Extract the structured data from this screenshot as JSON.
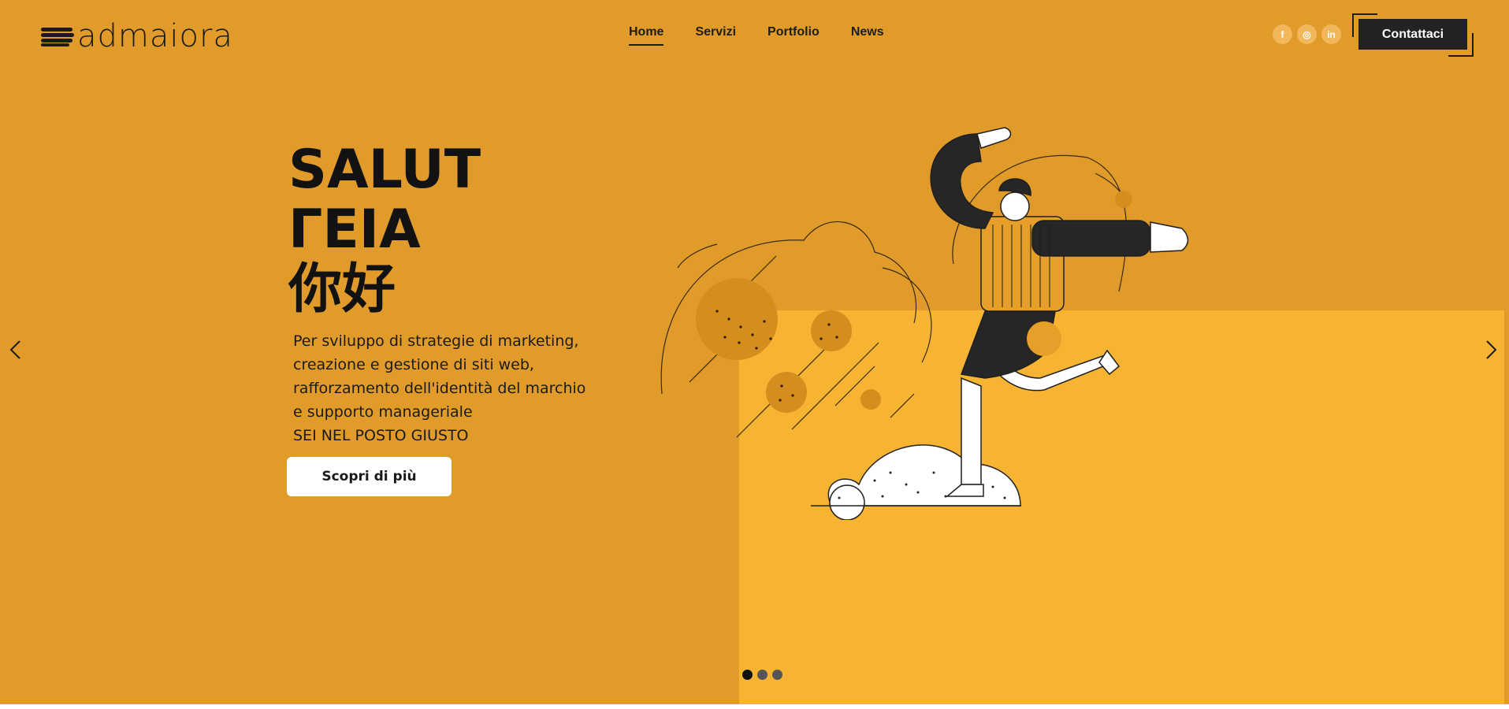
{
  "brand": {
    "name": "admaiora"
  },
  "nav": {
    "items": [
      {
        "label": "Home",
        "active": true
      },
      {
        "label": "Servizi",
        "active": false
      },
      {
        "label": "Portfolio",
        "active": false
      },
      {
        "label": "News",
        "active": false
      }
    ]
  },
  "socials": [
    {
      "icon": "facebook-icon",
      "glyph": "f"
    },
    {
      "icon": "instagram-icon",
      "glyph": "◎"
    },
    {
      "icon": "linkedin-icon",
      "glyph": "in"
    }
  ],
  "contact_button": {
    "label": "Contattaci"
  },
  "hero": {
    "greetings": [
      "SALUT",
      "ΓΕΙΑ",
      "你好"
    ],
    "description_lines": [
      "Per sviluppo di strategie di marketing,",
      "creazione e gestione di siti web,",
      "rafforzamento dell'identità del marchio",
      "e supporto manageriale",
      "SEI NEL POSTO GIUSTO"
    ],
    "cta_label": "Scopri di più"
  },
  "slider": {
    "slide_count": 3,
    "active_slide": 1
  },
  "colors": {
    "background": "#e19b2a",
    "panel": "#f6b432",
    "dark": "#1d1d1d",
    "white": "#ffffff"
  }
}
